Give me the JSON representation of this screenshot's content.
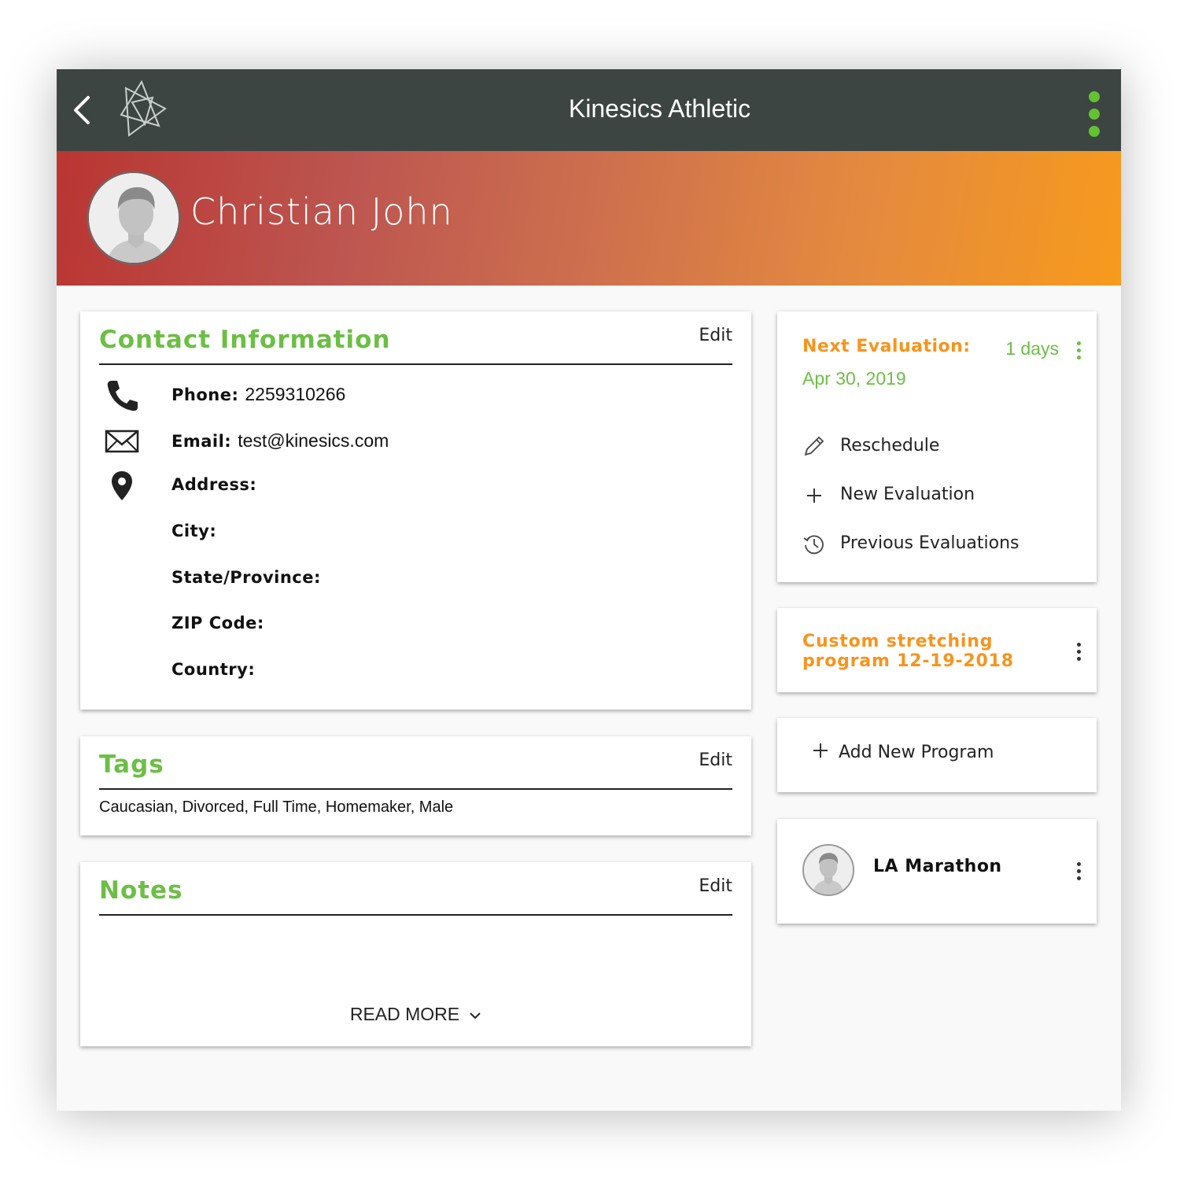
{
  "header": {
    "title": "Kinesics Athletic",
    "back_icon": "chevron-left-icon",
    "logo_icon": "triangles-logo",
    "menu_icon": "kebab-vertical-icon",
    "menu_color": "#63c132",
    "bar_color": "#3d4542"
  },
  "profile": {
    "name": "Christian John",
    "gradient": [
      "#b93532",
      "#f79a1d"
    ]
  },
  "contact": {
    "title": "Contact Information",
    "edit_label": "Edit",
    "phone_label": "Phone:",
    "phone_value": "2259310266",
    "email_label": "Email:",
    "email_value": "test@kinesics.com",
    "address_label": "Address:",
    "city_label": "City:",
    "state_label": "State/Province:",
    "zip_label": "ZIP Code:",
    "country_label": "Country:"
  },
  "tags": {
    "title": "Tags",
    "edit_label": "Edit",
    "values": "Caucasian, Divorced, Full Time, Homemaker, Male"
  },
  "notes": {
    "title": "Notes",
    "edit_label": "Edit",
    "read_more": "READ MORE"
  },
  "evaluation": {
    "label": "Next Evaluation:",
    "days": "1 days",
    "date": "Apr 30, 2019",
    "actions": [
      "Reschedule",
      "New Evaluation",
      "Previous Evaluations"
    ]
  },
  "program": {
    "title": "Custom stretching program 12-19-2018",
    "add_label": "Add New Program"
  },
  "event": {
    "name": "LA Marathon"
  },
  "colors": {
    "accent_green": "#6cbf45",
    "accent_orange": "#f7941d"
  }
}
